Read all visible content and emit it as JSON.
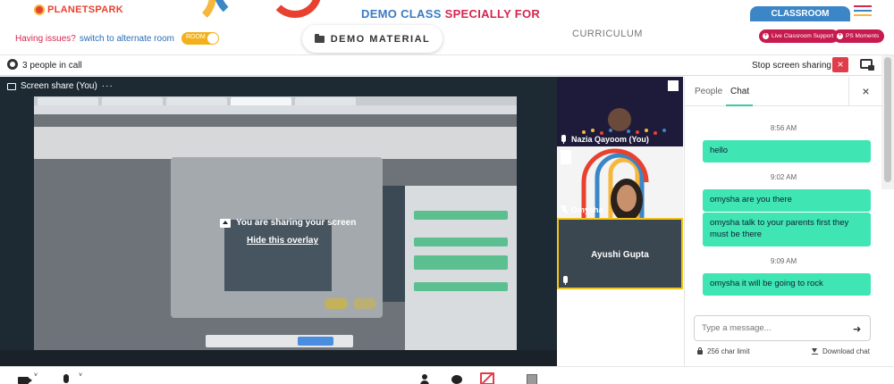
{
  "banner": {
    "logo_text": "PLANETSPARK",
    "title_main": "DEMO CLASS ",
    "title_highlight": "SPECIALLY FOR",
    "classroom_label": "CLASSROOM",
    "issues_text": "Having issues?",
    "switch_link": "switch to alternate room",
    "toggle_label": "ROOM",
    "demo_material_label": "DEMO MATERIAL",
    "curriculum_label": "CURRICULUM",
    "support_label": "Live Classroom Support",
    "moments_label": "PS Moments",
    "colors": {
      "accent_red": "#d6264f",
      "accent_blue": "#3a7ac4",
      "pill": "#c71a4f"
    }
  },
  "callbar": {
    "people_count": "3 people in call",
    "stop_share_label": "Stop screen sharing",
    "stop_icon": "×"
  },
  "share": {
    "label": "Screen share (You)",
    "more": "···",
    "overlay_message": "You are sharing your screen",
    "hide_overlay": "Hide this overlay"
  },
  "tiles": [
    {
      "name": "Nazia Qayoom (You)",
      "mic": "on"
    },
    {
      "name": "Omysha",
      "mic": "off"
    },
    {
      "name": "Ayushi Gupta",
      "mic": "on",
      "active_speaker": true
    }
  ],
  "chat": {
    "tab_people": "People",
    "tab_chat": "Chat",
    "close": "×",
    "messages": [
      {
        "time": "8:56 AM",
        "texts": [
          "hello"
        ]
      },
      {
        "time": "9:02 AM",
        "texts": [
          "omysha are you there",
          "omysha talk to your parents first they must be there"
        ]
      },
      {
        "time": "9:09 AM",
        "texts": [
          "omysha it will be going to rock"
        ]
      }
    ],
    "input_placeholder": "Type a message...",
    "send": "➜",
    "char_limit": "256 char limit",
    "download": "Download chat",
    "bubble_color": "#3fe5b3"
  },
  "toolbar": {
    "chevron": "˅"
  }
}
